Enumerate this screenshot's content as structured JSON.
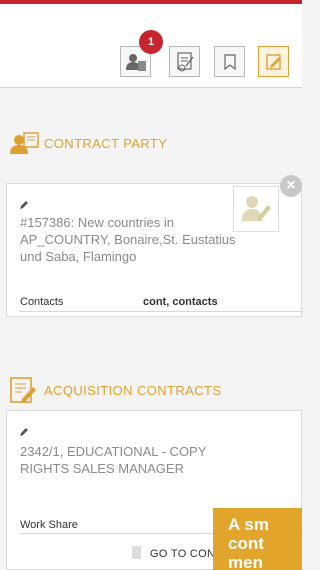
{
  "toolbar": {
    "notification_count": "1",
    "buttons": [
      "contacts-icon",
      "edit-document-icon",
      "bookmark-icon",
      "edit-icon"
    ]
  },
  "contract_party": {
    "title": "CONTRACT PARTY",
    "description": "#157386: New countries in AP_COUNTRY, Bonaire,St. Eustatius und Saba, Flamingo",
    "field_label": "Contacts",
    "field_value": "cont, contacts"
  },
  "acquisition_contracts": {
    "title": "ACQUISITION CONTRACTS",
    "description": "2342/1, EDUCATIONAL - COPY RIGHTS SALES MANAGER",
    "field_label": "Work Share",
    "goto_label": "GO TO CONT"
  },
  "overlay": {
    "line1": "A sm",
    "line2": "cont",
    "line3": "men"
  },
  "colors": {
    "accent": "#e0a030",
    "top_bar": "#c9232d",
    "badge": "#c8242f",
    "overlay": "#e0a52a"
  }
}
